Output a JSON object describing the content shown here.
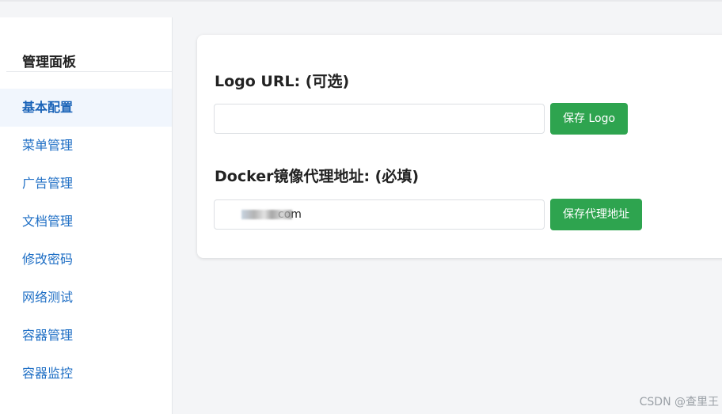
{
  "sidebar": {
    "title": "管理面板",
    "items": [
      {
        "label": "基本配置",
        "active": true
      },
      {
        "label": "菜单管理"
      },
      {
        "label": "广告管理"
      },
      {
        "label": "文档管理"
      },
      {
        "label": "修改密码"
      },
      {
        "label": "网络测试"
      },
      {
        "label": "容器管理"
      },
      {
        "label": "容器监控"
      }
    ]
  },
  "form": {
    "logo": {
      "label": "Logo URL: (可选)",
      "value": "",
      "button": "保存 Logo"
    },
    "proxy": {
      "label": "Docker镜像代理地址: (必填)",
      "value": "com",
      "button": "保存代理地址"
    }
  },
  "watermark": "CSDN @查里王",
  "colors": {
    "accent_green": "#2ea44f",
    "link_blue": "#1f6fc5"
  }
}
